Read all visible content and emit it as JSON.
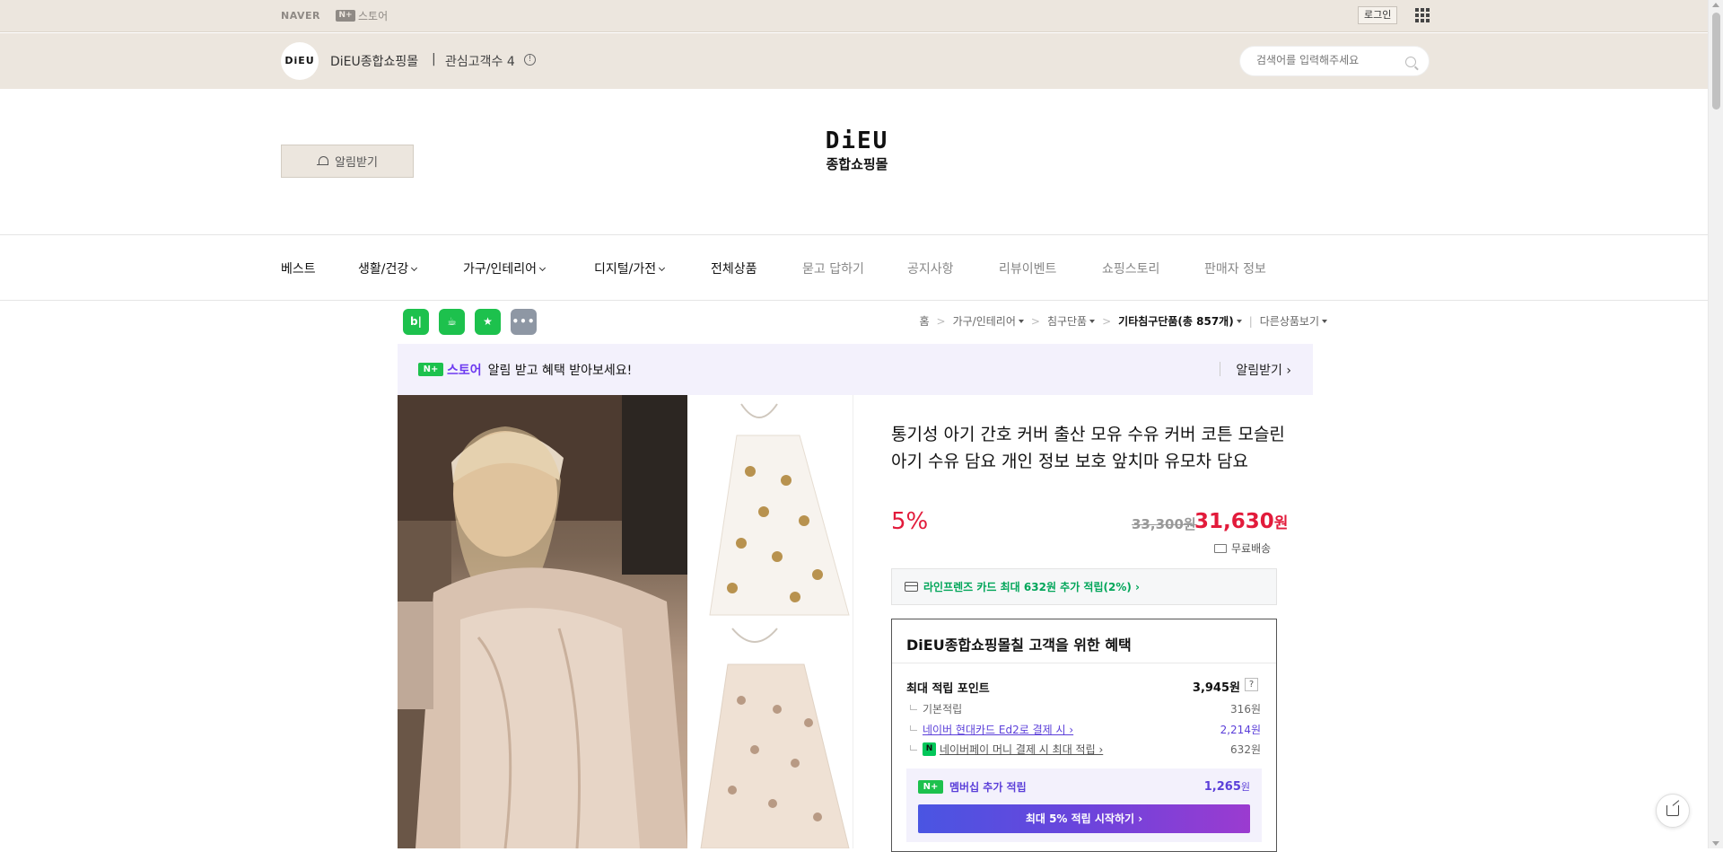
{
  "topbar": {
    "naver": "NAVER",
    "nplus_store": "스토어",
    "login": "로그인"
  },
  "store": {
    "logo": "DiEU",
    "name": "DiEU종합쇼핑몰",
    "separator": "|",
    "fans": "관심고객수 4",
    "search_placeholder": "검색어를 입력해주세요"
  },
  "header": {
    "notify": "알림받기",
    "logo_line1": "DiEU",
    "logo_line2": "종합쇼핑몰"
  },
  "nav": {
    "items": [
      "베스트",
      "생활/건강",
      "가구/인테리어",
      "디지털/가전",
      "전체상품",
      "묻고 답하기",
      "공지사항",
      "리뷰이벤트",
      "쇼핑스토리",
      "판매자 정보"
    ]
  },
  "badges": [
    "b|",
    "☕",
    "★",
    "•••"
  ],
  "breadcrumb": {
    "home": "홈",
    "c1": "가구/인테리어",
    "c2": "침구단품",
    "c3": "기타침구단품(총 857개)",
    "other": "다른상품보기"
  },
  "promo": {
    "store": "스토어",
    "message": "알림 받고 혜택 받아보세요!",
    "alert": "알림받기 ›"
  },
  "product": {
    "title": "통기성 아기 간호 커버 출산 모유 수유 커버 코튼 모슬린 아기 수유 담요 개인 정보 보호 앞치마 유모차 담요",
    "discount": "5%",
    "original_price": "33,300원",
    "sale_price": "31,630",
    "won": "원",
    "shipping": "무료배송",
    "card_benefit": "라인프렌즈 카드 최대 632원 추가 적립(2%) ›"
  },
  "benefits": {
    "title": "DiEU종합쇼핑몰칠 고객을 위한 혜택",
    "max_points_label": "최대 적립 포인트",
    "max_points_value": "3,945원",
    "help": "?",
    "rows": [
      {
        "label": "기본적립",
        "value": "316원"
      },
      {
        "label": "네이버 현대카드 Ed2로 결제 시 ›",
        "value": "2,214원"
      },
      {
        "label": "네이버페이 머니 결제 시 최대 적립 ›",
        "value": "632원"
      }
    ],
    "membership_label": "멤버십 추가 적립",
    "membership_value": "1,265",
    "membership_won": "원",
    "membership_button": "최대 5% 적립 시작하기 ›"
  },
  "colors": {
    "header_bg": "#ece6de",
    "sale_red": "#e21b3b",
    "naver_green": "#1dc14d",
    "purple": "#5b3fd9"
  }
}
